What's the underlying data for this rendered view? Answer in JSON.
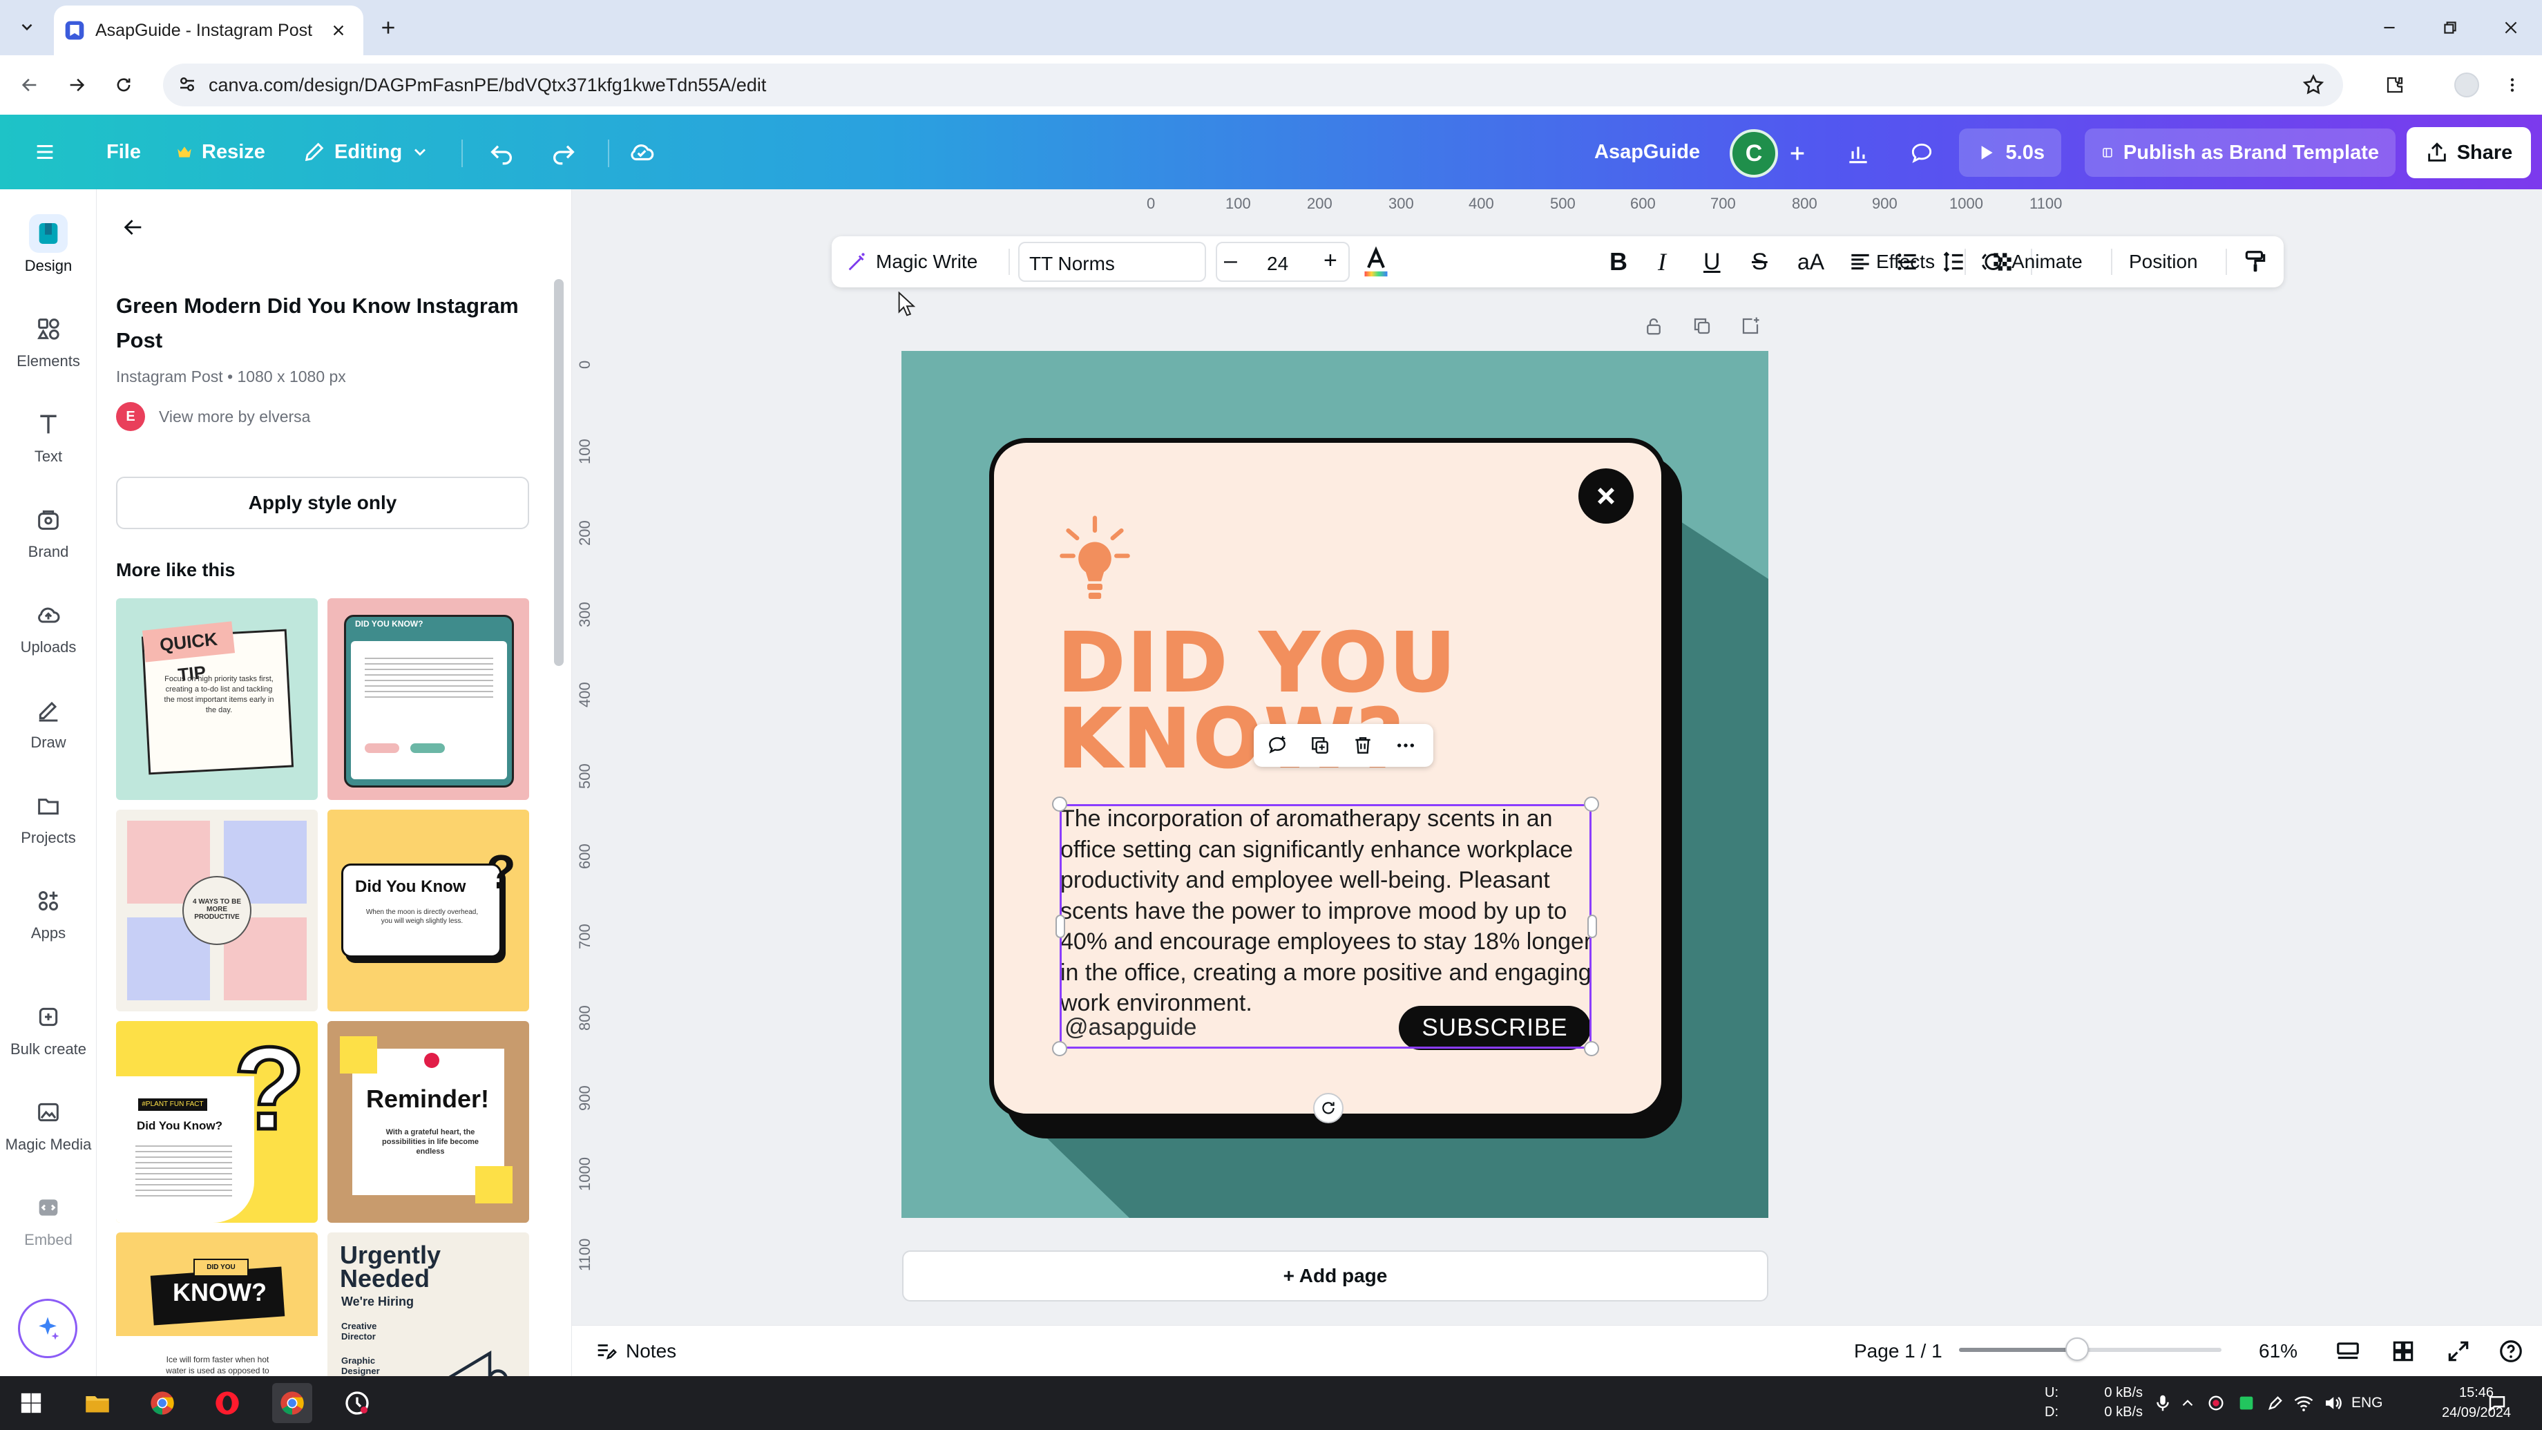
{
  "browser": {
    "tab_title": "AsapGuide - Instagram Post",
    "url": "canva.com/design/DAGPmFasnPE/bdVQtx371kfg1kweTdn55A/edit"
  },
  "header": {
    "file": "File",
    "resize": "Resize",
    "editing": "Editing",
    "design_name": "AsapGuide",
    "avatar_initial": "C",
    "play_time": "5.0s",
    "publish": "Publish as Brand Template",
    "share": "Share",
    "colors": {
      "gradient_start": "#1ec3c7",
      "gradient_end": "#7c3aed"
    }
  },
  "rail": {
    "items": [
      {
        "label": "Design",
        "icon": "design-icon"
      },
      {
        "label": "Elements",
        "icon": "elements-icon"
      },
      {
        "label": "Text",
        "icon": "text-icon"
      },
      {
        "label": "Brand",
        "icon": "brand-icon"
      },
      {
        "label": "Uploads",
        "icon": "uploads-icon"
      },
      {
        "label": "Draw",
        "icon": "draw-icon"
      },
      {
        "label": "Projects",
        "icon": "projects-icon"
      },
      {
        "label": "Apps",
        "icon": "apps-icon"
      },
      {
        "label": "Bulk create",
        "icon": "bulk-create-icon"
      },
      {
        "label": "Magic Media",
        "icon": "magic-media-icon"
      },
      {
        "label": "Embed",
        "icon": "embed-icon"
      }
    ]
  },
  "panel": {
    "title": "Green Modern Did You Know Instagram Post",
    "meta": "Instagram Post • 1080 x 1080 px",
    "author_initial": "E",
    "author": "View more by elversa",
    "apply_btn": "Apply style only",
    "more_like": "More like this",
    "thumbs": [
      {
        "t1": "QUICK TIP",
        "t2": "Focus on high priority tasks first, creating a to-do list and tackling the most important items early in the day."
      },
      {
        "t1": "DID YOU KNOW?"
      },
      {
        "t1": "4 WAYS TO BE MORE PRODUCTIVE"
      },
      {
        "t1": "Did You Know",
        "t2": "When the moon is directly overhead, you will weigh slightly less."
      },
      {
        "t1": "Did You Know?",
        "t2": "#PLANT FUN FACT"
      },
      {
        "t1": "Reminder!",
        "t2": "With a grateful heart, the possibilities in life become endless"
      },
      {
        "t1": "DID YOU KNOW?",
        "t2": "Ice will form faster when hot water is used as opposed to cold water."
      },
      {
        "t1": "Urgently Needed",
        "t2": "We're Hiring",
        "t3": "Creative Director",
        "t4": "Graphic Designer"
      }
    ]
  },
  "toolbar": {
    "magic_write": "Magic Write",
    "font": "TT Norms",
    "size": "24",
    "effects": "Effects",
    "animate": "Animate",
    "position": "Position"
  },
  "rulers": {
    "top": [
      "0",
      "100",
      "200",
      "300",
      "400",
      "500",
      "600",
      "700",
      "800",
      "900",
      "1000",
      "1100"
    ],
    "left": [
      "0",
      "100",
      "200",
      "300",
      "400",
      "500",
      "600",
      "700",
      "800",
      "900",
      "1000",
      "1100"
    ]
  },
  "design": {
    "headline_line1": "DID YOU",
    "headline_line2": "KNOW?",
    "body": "The incorporation of aromatherapy scents in an office setting can significantly enhance workplace productivity and employee well-being. Pleasant scents have the power to improve mood by up to 40% and encourage employees to stay 18% longer in the office, creating a more positive and engaging work environment.",
    "handle": "@asapguide",
    "subscribe": "SUBSCRIBE",
    "colors": {
      "background": "#6eb1ab",
      "card": "#fdece1",
      "accent": "#f28f5d"
    }
  },
  "canvas": {
    "add_page": "+ Add page"
  },
  "footer": {
    "notes": "Notes",
    "page": "Page 1 / 1",
    "zoom": "61%",
    "zoom_fraction": 0.45
  },
  "taskbar": {
    "net_up_label": "U:",
    "net_down_label": "D:",
    "net_up": "0 kB/s",
    "net_down": "0 kB/s",
    "lang": "ENG",
    "time": "15:46",
    "date": "24/09/2024"
  }
}
